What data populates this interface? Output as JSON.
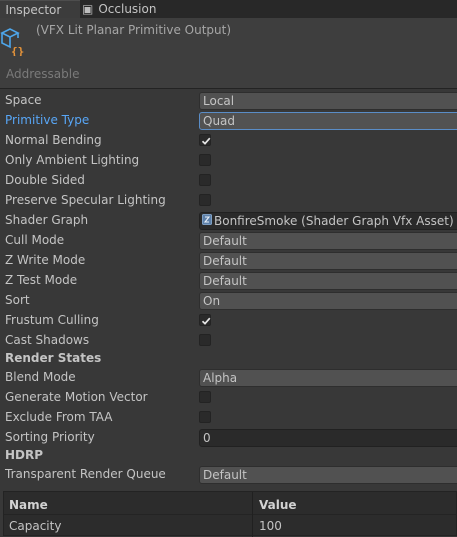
{
  "tabs": [
    {
      "label": "Inspector",
      "glyph": "i"
    },
    {
      "label": "Occlusion",
      "glyph": "▣"
    }
  ],
  "header": {
    "title": "(VFX Lit Planar Primitive Output)",
    "addressable": "Addressable"
  },
  "properties": {
    "space": {
      "label": "Space",
      "value": "Local"
    },
    "primitive_type": {
      "label": "Primitive Type",
      "value": "Quad"
    },
    "normal_bending": {
      "label": "Normal Bending",
      "checked": true
    },
    "only_ambient_lighting": {
      "label": "Only Ambient Lighting",
      "checked": false
    },
    "double_sided": {
      "label": "Double Sided",
      "checked": false
    },
    "preserve_specular_lighting": {
      "label": "Preserve Specular Lighting",
      "checked": false
    },
    "shader_graph": {
      "label": "Shader Graph",
      "value": "BonfireSmoke (Shader Graph Vfx Asset)"
    },
    "cull_mode": {
      "label": "Cull Mode",
      "value": "Default"
    },
    "z_write_mode": {
      "label": "Z Write Mode",
      "value": "Default"
    },
    "z_test_mode": {
      "label": "Z Test Mode",
      "value": "Default"
    },
    "sort": {
      "label": "Sort",
      "value": "On"
    },
    "frustum_culling": {
      "label": "Frustum Culling",
      "checked": true
    },
    "cast_shadows": {
      "label": "Cast Shadows",
      "checked": false
    },
    "render_states": {
      "label": "Render States"
    },
    "blend_mode": {
      "label": "Blend Mode",
      "value": "Alpha"
    },
    "generate_motion_vector": {
      "label": "Generate Motion Vector",
      "checked": false
    },
    "exclude_from_taa": {
      "label": "Exclude From TAA",
      "checked": false
    },
    "sorting_priority": {
      "label": "Sorting Priority",
      "value": "0"
    },
    "hdrp": {
      "label": "HDRP"
    },
    "transparent_render_queue": {
      "label": "Transparent Render Queue",
      "value": "Default"
    }
  },
  "table": {
    "headers": {
      "name": "Name",
      "value": "Value"
    },
    "rows": [
      {
        "name": "Capacity",
        "value": "100"
      }
    ]
  },
  "colors": {
    "accent": "#58a6f6",
    "background": "#383838",
    "icon_blue": "#4ea6ea",
    "icon_orange": "#e8953a"
  }
}
